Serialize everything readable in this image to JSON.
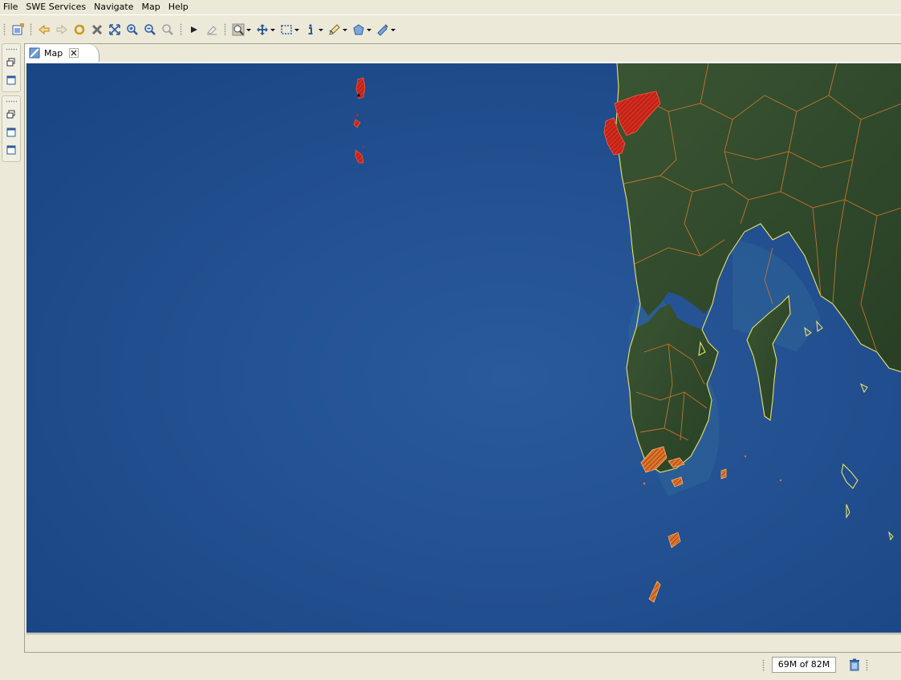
{
  "menu": {
    "items": [
      {
        "label": "File"
      },
      {
        "label": "SWE Services"
      },
      {
        "label": "Navigate"
      },
      {
        "label": "Map"
      },
      {
        "label": "Help"
      }
    ]
  },
  "toolbar": {
    "buttons": [
      {
        "icon": "new-layer-icon"
      },
      {
        "icon": "back-icon"
      },
      {
        "icon": "forward-icon"
      },
      {
        "icon": "refresh-icon"
      },
      {
        "icon": "stop-icon"
      },
      {
        "icon": "zoom-extent-icon"
      },
      {
        "icon": "zoom-in-icon"
      },
      {
        "icon": "zoom-out-icon"
      },
      {
        "icon": "zoom-selection-icon"
      },
      {
        "icon": "next-icon"
      },
      {
        "icon": "eraser-icon"
      },
      {
        "icon": "zoom-tool-icon"
      },
      {
        "icon": "pan-tool-icon"
      },
      {
        "icon": "select-tool-icon"
      },
      {
        "icon": "info-tool-icon"
      },
      {
        "icon": "edit-tool-icon"
      },
      {
        "icon": "shape-tool-icon"
      },
      {
        "icon": "plugin-tool-icon"
      }
    ]
  },
  "editor": {
    "tab_label": "Map",
    "map_colors": {
      "ocean": "#1c4a8a",
      "land": "#2f4a2a",
      "boundary": "#c8782e",
      "coast": "#e8e26a",
      "highlight": "#d62b1e"
    }
  },
  "status": {
    "heap": "69M of 82M"
  }
}
